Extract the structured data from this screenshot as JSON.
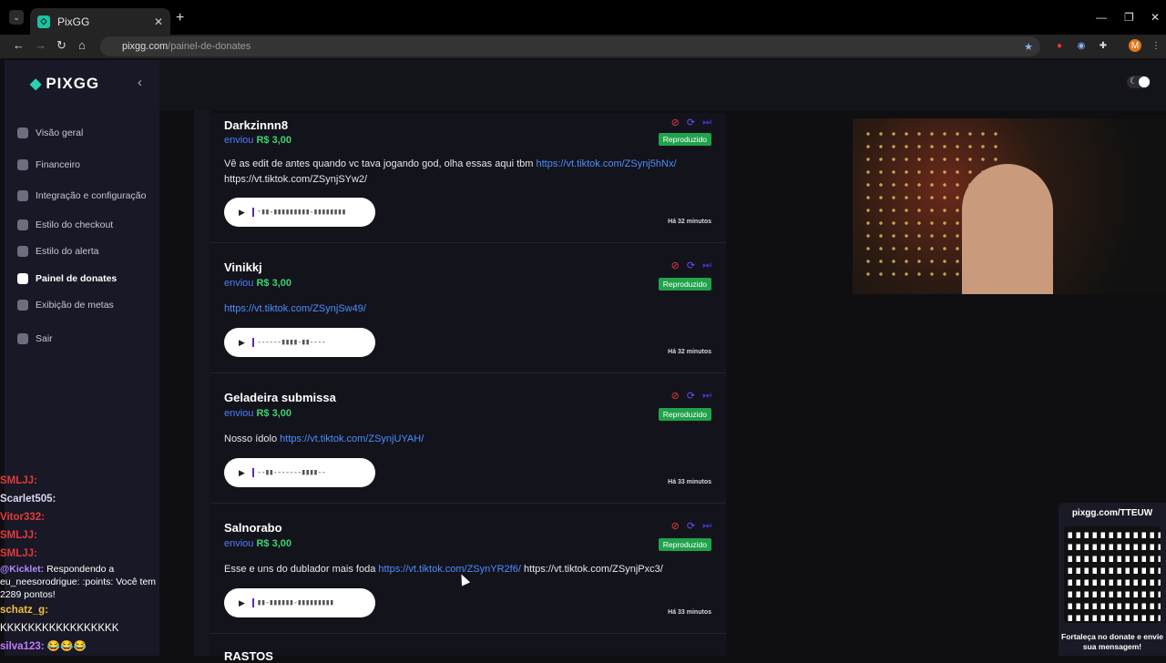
{
  "browser": {
    "tab_title": "PixGG",
    "url_domain": "pixgg.com",
    "url_path": "/painel-de-donates"
  },
  "sidebar": {
    "logo": "PIXGG",
    "items": [
      {
        "label": "Visão geral",
        "icon": "home-icon"
      },
      {
        "label": "Financeiro",
        "icon": "wallet-icon"
      },
      {
        "label": "Integração e configuração",
        "icon": "settings-icon"
      },
      {
        "label": "Estilo do checkout",
        "icon": "palette-icon"
      },
      {
        "label": "Estilo do alerta",
        "icon": "bell-icon"
      },
      {
        "label": "Painel de donates",
        "icon": "donate-icon"
      },
      {
        "label": "Exibição de metas",
        "icon": "star-icon"
      },
      {
        "label": "Sair",
        "icon": "logout-icon"
      }
    ]
  },
  "donations": [
    {
      "name": "Darkzinnn8",
      "sent": "enviou",
      "amount": "R$ 3,00",
      "status": "Reproduzido",
      "message": "Vê as edit de antes quando vc tava jogando god, olha essas aqui tbm ",
      "link": "https://vt.tiktok.com/ZSynj5hNx/",
      "message2": "https://vt.tiktok.com/ZSynjSYw2/",
      "time": "Há 32 minutos"
    },
    {
      "name": "Vinikkj",
      "sent": "enviou",
      "amount": "R$ 3,00",
      "status": "Reproduzido",
      "message": "",
      "link": "https://vt.tiktok.com/ZSynjSw49/",
      "message2": "",
      "time": "Há 32 minutos"
    },
    {
      "name": "Geladeira submissa",
      "sent": "enviou",
      "amount": "R$ 3,00",
      "status": "Reproduzido",
      "message": "Nosso ídolo ",
      "link": "https://vt.tiktok.com/ZSynjUYAH/",
      "message2": "",
      "time": "Há 33 minutos"
    },
    {
      "name": "Salnorabo",
      "sent": "enviou",
      "amount": "R$ 3,00",
      "status": "Reproduzido",
      "message": "Esse e uns do dublador mais foda ",
      "link": "https://vt.tiktok.com/ZSynYR2f6/",
      "message2": " https://vt.tiktok.com/ZSynjPxc3/",
      "time": "Há 33 minutos"
    },
    {
      "name": "RASTOS",
      "sent": "",
      "amount": "",
      "status": "",
      "message": "",
      "link": "",
      "message2": "",
      "time": ""
    }
  ],
  "chat": [
    {
      "user": "SMLJJ:",
      "text": "",
      "color": "#e23b3b"
    },
    {
      "user": "Scarlet505:",
      "text": "",
      "color": "#d7d7f0"
    },
    {
      "user": "Vitor332:",
      "text": "",
      "color": "#e23b3b"
    },
    {
      "user": "SMLJJ:",
      "text": "",
      "color": "#e23b3b"
    },
    {
      "user": "SMLJJ:",
      "text": "",
      "color": "#e23b3b"
    },
    {
      "user": "@Kicklet:",
      "text": "Respondendo a eu_neesorodrigue: :points: Você tem 2289 pontos!",
      "color": "#b48cff"
    },
    {
      "user": "schatz_g:",
      "text": "KKKKKKKKKKKKKKKKK",
      "color": "#f0c040"
    },
    {
      "user": "silva123:",
      "text": "😂😂😂",
      "color": "#c07cff"
    }
  ],
  "qr": {
    "url": "pixgg.com/TTEUW",
    "caption": "Fortaleça no donate e envie sua mensagem!"
  },
  "colors": {
    "accent": "#27d3b0",
    "link": "#4d8dfc",
    "amount": "#3bd46f",
    "badge": "#20a34a"
  }
}
